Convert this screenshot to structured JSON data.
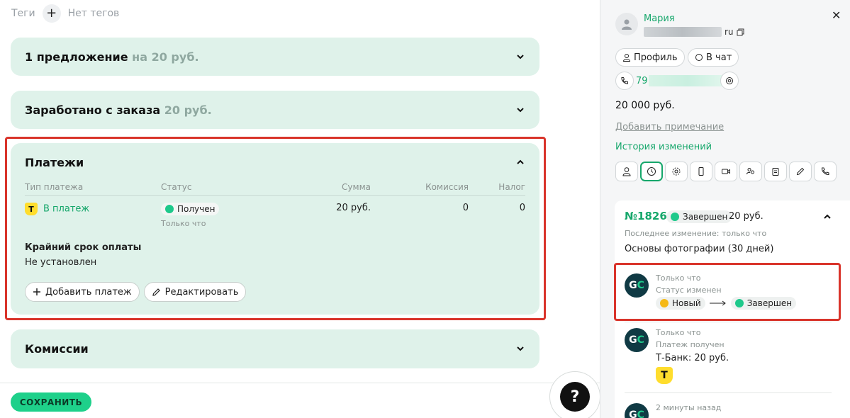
{
  "tags": {
    "label": "Теги",
    "empty": "Нет тегов",
    "add_icon": "plus-icon"
  },
  "cards": {
    "offers": {
      "title": "1 предложение",
      "sub": "на 20 руб."
    },
    "earned": {
      "title": "Заработано с заказа",
      "sub": "20 руб."
    },
    "payments": {
      "title": "Платежи",
      "columns": [
        "Тип платежа",
        "Статус",
        "Сумма",
        "Комиссия",
        "Налог"
      ],
      "rows": [
        {
          "type": "В платеж",
          "status": "Получен",
          "status_time": "Только что",
          "amount": "20 руб.",
          "commission": "0",
          "tax": "0"
        }
      ],
      "deadline_label": "Крайний срок оплаты",
      "deadline_value": "Не установлен",
      "add_payment": "Добавить платеж",
      "edit": "Редактировать"
    },
    "commissions": {
      "title": "Комиссии"
    }
  },
  "footer": {
    "save": "СОХРАНИТЬ",
    "help": "?"
  },
  "sidebar": {
    "name": "Мария",
    "email_suffix": "ru",
    "profile": "Профиль",
    "chat": "В чат",
    "phone_prefix": "79",
    "amount": "20 000 руб.",
    "add_note": "Добавить примечание",
    "history": "История изменений",
    "order": {
      "number": "№1826",
      "status": "Завершен",
      "sum": "20 руб.",
      "last_change": "Последнее изменение: только что",
      "course": "Основы фотографии (30 дней)"
    },
    "events": [
      {
        "time": "Только что",
        "desc": "Статус изменен",
        "from": "Новый",
        "to": "Завершен"
      },
      {
        "time": "Только что",
        "desc": "Платеж получен",
        "text": "Т-Банк: 20 руб."
      },
      {
        "time": "2 минуты назад"
      }
    ]
  },
  "colors": {
    "accent": "#16a76b",
    "card_bg": "#dff2ea",
    "highlight": "#d9342b",
    "save": "#1ed08a"
  }
}
